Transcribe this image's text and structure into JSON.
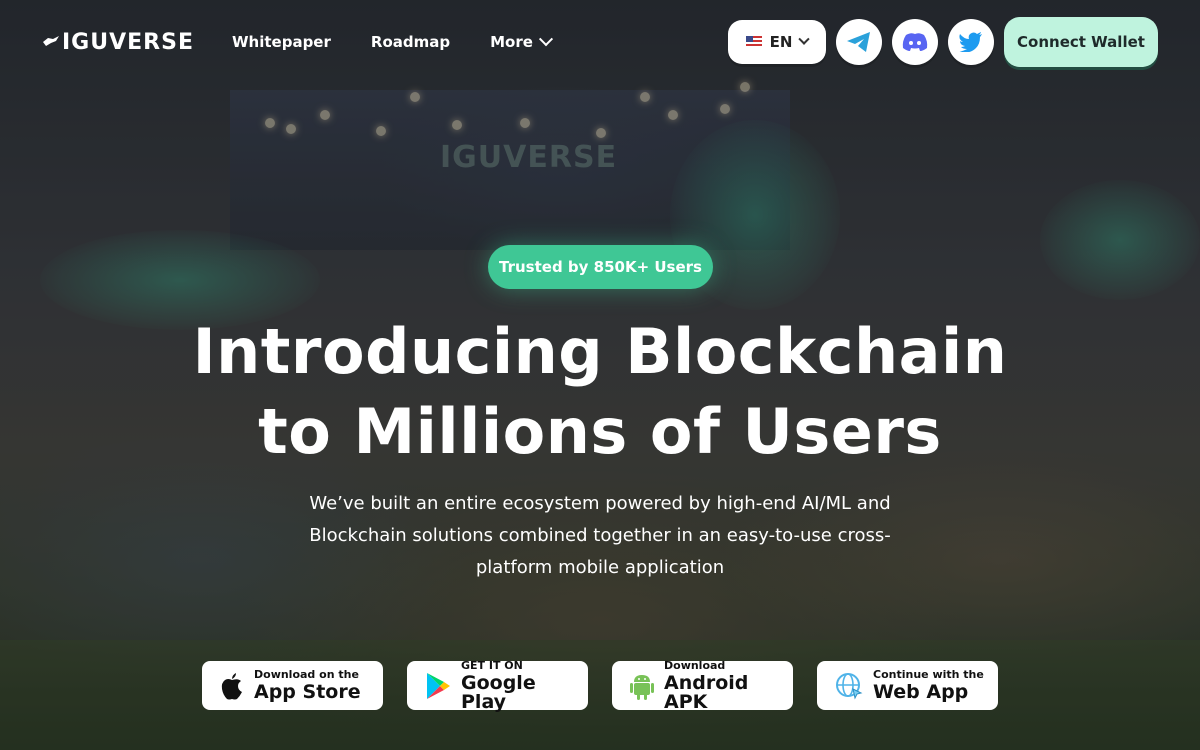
{
  "brand": {
    "logo_text": "IGUVERSE",
    "logo_icon": "iguana-icon"
  },
  "nav": {
    "items": [
      {
        "label": "Whitepaper"
      },
      {
        "label": "Roadmap"
      },
      {
        "label": "More",
        "icon": "chevron-down-icon"
      }
    ]
  },
  "header": {
    "language": {
      "value": "EN",
      "icon": "us-flag-icon"
    },
    "socials": [
      {
        "name": "telegram-icon",
        "color": "#2aa1da"
      },
      {
        "name": "discord-icon",
        "color": "#5865f2"
      },
      {
        "name": "twitter-icon",
        "color": "#1d9bf0"
      }
    ],
    "connect_label": "Connect Wallet"
  },
  "hero": {
    "badge": "Trusted by 850K+ Users",
    "title_line1": "Introducing Blockchain",
    "title_line2": "to Millions of Users",
    "subtitle": "We’ve built an entire ecosystem powered by high-end AI/ML and Blockchain solutions combined together in an easy-to-use cross-platform mobile application"
  },
  "stores": [
    {
      "small": "Download on the",
      "big": "App Store",
      "icon": "apple-icon"
    },
    {
      "small": "GET IT ON",
      "big": "Google Play",
      "icon": "google-play-icon"
    },
    {
      "small": "Download",
      "big": "Android APK",
      "icon": "android-icon"
    },
    {
      "small": "Continue with the",
      "big": "Web App",
      "icon": "globe-icon"
    }
  ],
  "colors": {
    "accent": "#3fc795",
    "connect_bg": "#bff3de"
  }
}
